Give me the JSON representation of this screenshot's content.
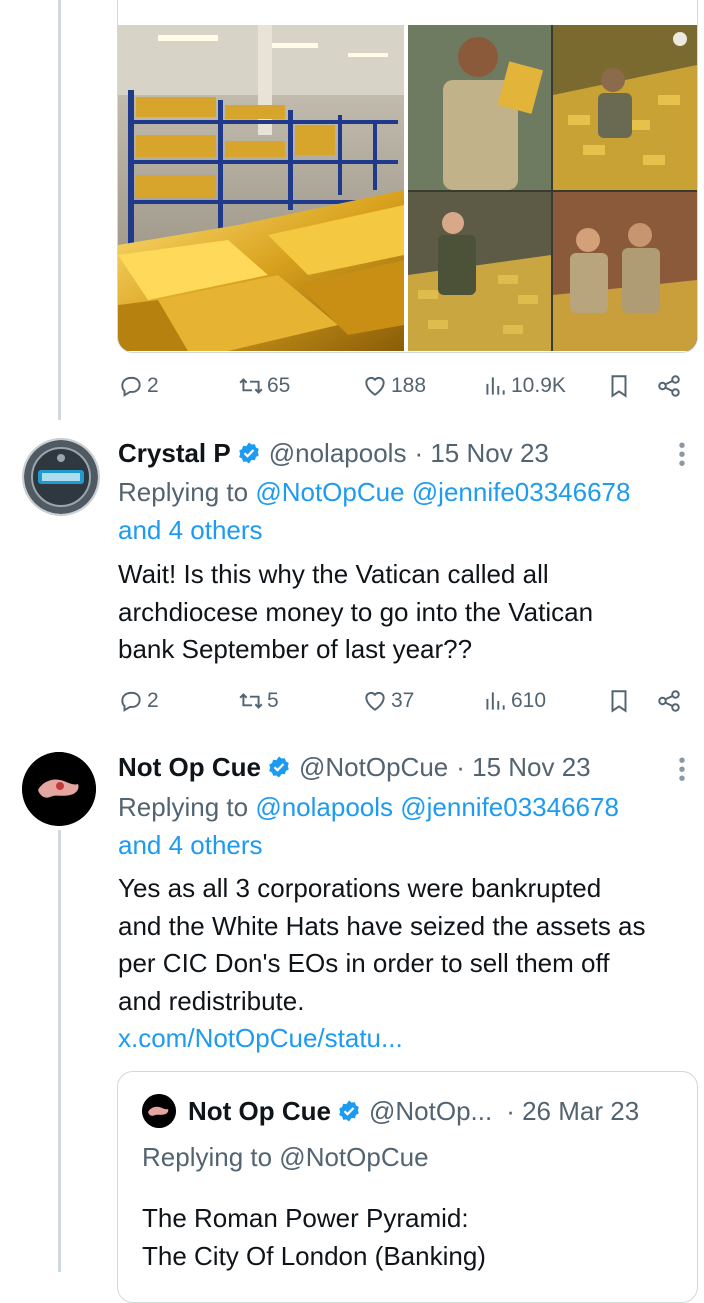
{
  "top_post": {
    "media_alt": [
      "Gold bars stacked in warehouse shelves",
      "Collage of soldiers with gold bars"
    ],
    "stats": {
      "replies": "2",
      "reposts": "65",
      "likes": "188",
      "views": "10.9K"
    }
  },
  "reply1": {
    "name": "Crystal P",
    "handle": "@nolapools",
    "date": "· 15 Nov 23",
    "replying_prefix": "Replying to ",
    "replying_users": "@NotOpCue @jennife03346678",
    "replying_others": "and 4 others",
    "text": [
      "Wait!  Is this why the Vatican called all",
      "archdiocese money to go into the Vatican",
      "bank September of last year??"
    ],
    "stats": {
      "replies": "2",
      "reposts": "5",
      "likes": "37",
      "views": "610"
    }
  },
  "reply2": {
    "name": "Not Op Cue",
    "handle": "@NotOpCue",
    "date": "· 15 Nov 23",
    "replying_prefix": "Replying to ",
    "replying_users": "@nolapools @jennife03346678",
    "replying_others": "and 4 others",
    "text": [
      "Yes as all 3 corporations were bankrupted",
      "and the White Hats have seized the assets as",
      "per CIC Don's EOs in order to sell them off",
      "and redistribute."
    ],
    "link": "x.com/NotOpCue/statu...",
    "quote": {
      "name": "Not Op Cue",
      "handle": "@NotOp...",
      "date": "· 26 Mar 23",
      "replying": "Replying to @NotOpCue",
      "text": [
        "The Roman Power Pyramid:",
        "The City Of London (Banking)"
      ]
    }
  },
  "colors": {
    "link": "#1d9bf0",
    "muted": "#536471",
    "verified": "#1d9bf0",
    "gold": "#d4a62a"
  }
}
